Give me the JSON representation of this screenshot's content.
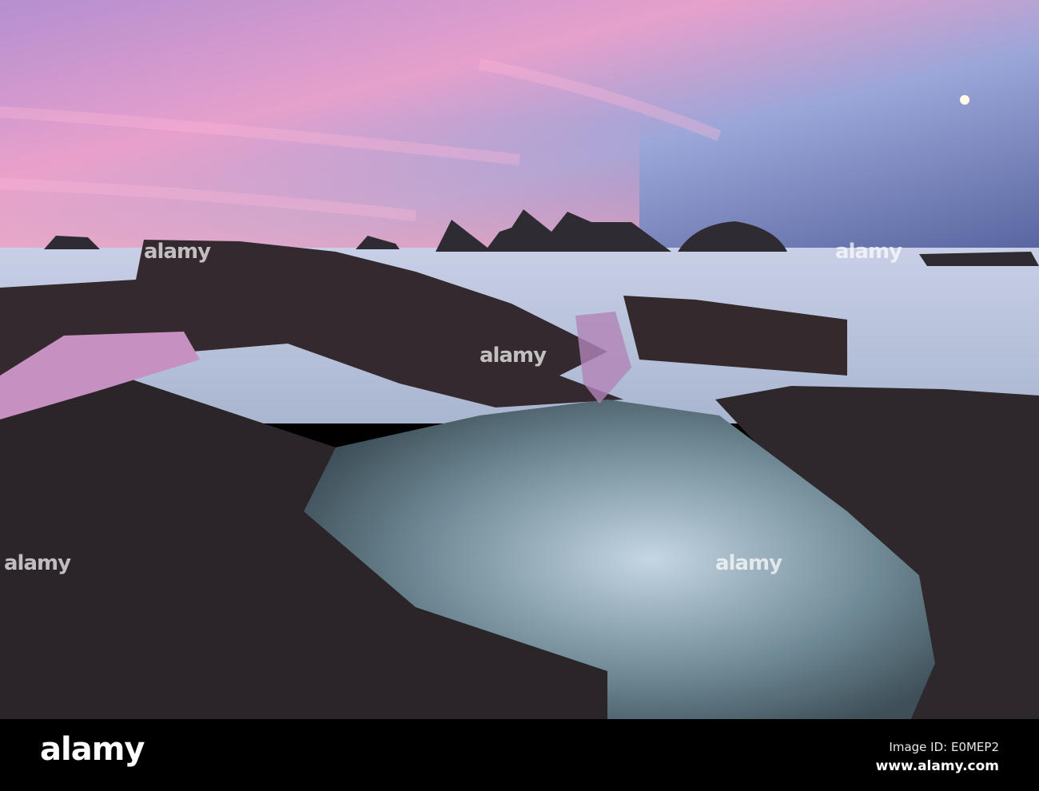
{
  "watermark": {
    "brand": "alamy",
    "image_id": "Image ID: E0MEP2",
    "website": "www.alamy.com"
  },
  "colors": {
    "sky_pink": "#e89ac8",
    "sky_blue": "#6d7cb8",
    "rock": "#2e2a2e",
    "water": "#7a8fa0"
  }
}
